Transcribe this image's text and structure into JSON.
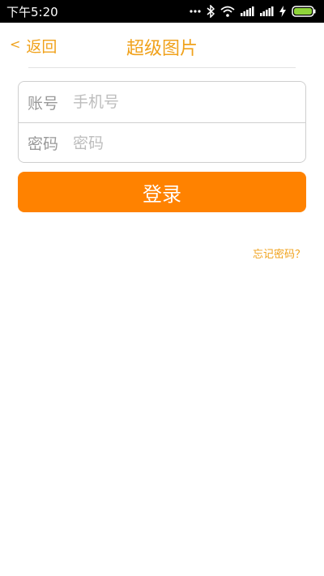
{
  "status_bar": {
    "time": "下午5:20",
    "icons": [
      "more-dots-icon",
      "bluetooth-icon",
      "wifi-icon",
      "signal-icon",
      "signal-icon",
      "charging-icon",
      "battery-icon"
    ]
  },
  "nav": {
    "back_chevron": "<",
    "back_label": "返回",
    "title": "超级图片"
  },
  "form": {
    "account_label": "账号",
    "account_placeholder": "手机号",
    "account_value": "",
    "password_label": "密码",
    "password_placeholder": "密码",
    "password_value": ""
  },
  "login_button": {
    "label": "登录"
  },
  "forgot_password": {
    "label": "忘记密码？"
  },
  "colors": {
    "accent_text": "#f0a21c",
    "button": "#ff8200",
    "status_bar": "#000000",
    "battery_fill": "#8fd43a"
  }
}
